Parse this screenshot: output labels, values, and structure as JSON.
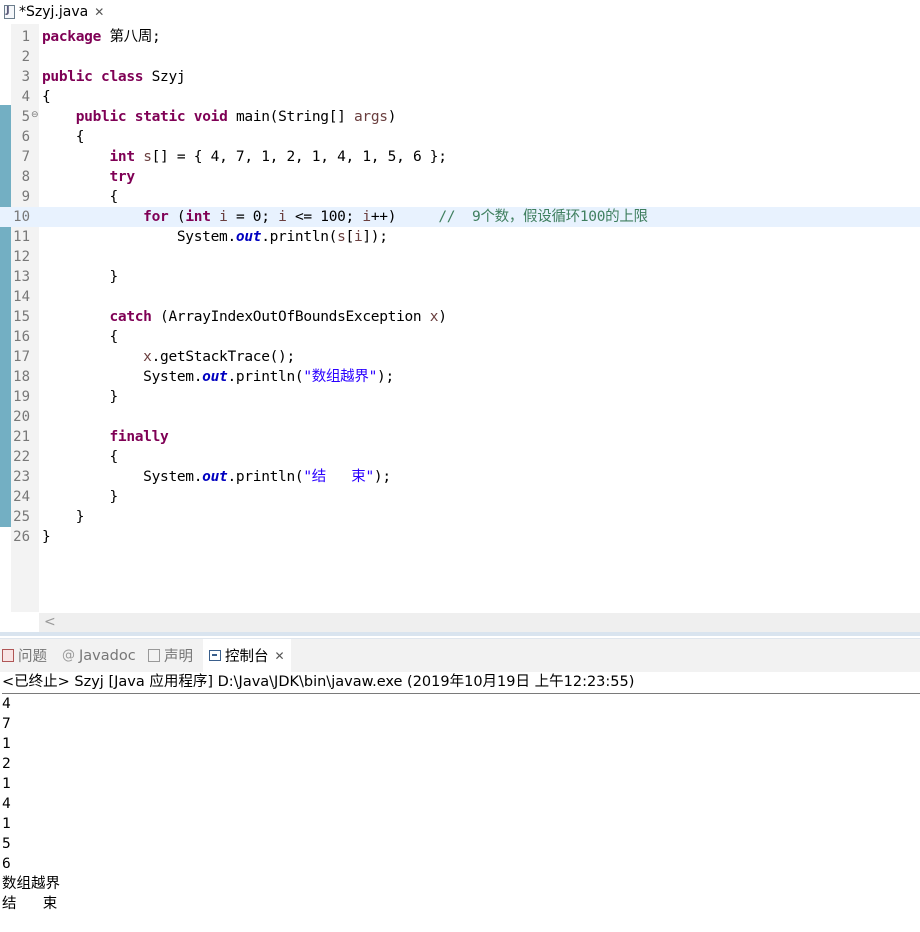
{
  "editor_tab": {
    "title": "*Szyj.java",
    "close": "✕"
  },
  "code_lines": [
    {
      "n": "1",
      "html": "<span class=\"kw\">package</span> 第八周;"
    },
    {
      "n": "2",
      "html": ""
    },
    {
      "n": "3",
      "html": "<span class=\"kw\">public</span> <span class=\"kw\">class</span> Szyj"
    },
    {
      "n": "4",
      "html": "{"
    },
    {
      "n": "5",
      "html": "    <span class=\"kw\">public</span> <span class=\"kw\">static</span> <span class=\"kw\">void</span> main(String[] <span class=\"par\">args</span>)",
      "fold": true
    },
    {
      "n": "6",
      "html": "    {"
    },
    {
      "n": "7",
      "html": "        <span class=\"kw\">int</span> <span class=\"par\">s</span>[] = { 4, 7, 1, 2, 1, 4, 1, 5, 6 };"
    },
    {
      "n": "8",
      "html": "        <span class=\"kw\">try</span>"
    },
    {
      "n": "9",
      "html": "        {"
    },
    {
      "n": "10",
      "html": "            <span class=\"kw\">for</span> (<span class=\"kw\">int</span> <span class=\"par\">i</span> = 0; <span class=\"par\">i</span> &lt;= 100; <span class=\"par\">i</span>++)     <span class=\"cmt\">//  9个数，假设循环100的上限</span>",
      "current": true
    },
    {
      "n": "11",
      "html": "                System.<span class=\"fld\">out</span>.println(<span class=\"par\">s</span>[<span class=\"par\">i</span>]);"
    },
    {
      "n": "12",
      "html": ""
    },
    {
      "n": "13",
      "html": "        }"
    },
    {
      "n": "14",
      "html": ""
    },
    {
      "n": "15",
      "html": "        <span class=\"kw\">catch</span> (ArrayIndexOutOfBoundsException <span class=\"par\">x</span>)"
    },
    {
      "n": "16",
      "html": "        {"
    },
    {
      "n": "17",
      "html": "            <span class=\"par\">x</span>.getStackTrace();"
    },
    {
      "n": "18",
      "html": "            System.<span class=\"fld\">out</span>.println(<span class=\"str\">\"数组越界\"</span>);"
    },
    {
      "n": "19",
      "html": "        }"
    },
    {
      "n": "20",
      "html": ""
    },
    {
      "n": "21",
      "html": "        <span class=\"kw\">finally</span>"
    },
    {
      "n": "22",
      "html": "        {"
    },
    {
      "n": "23",
      "html": "            System.<span class=\"fld\">out</span>.println(<span class=\"str\">\"结   束\"</span>);"
    },
    {
      "n": "24",
      "html": "        }"
    },
    {
      "n": "25",
      "html": "    }"
    },
    {
      "n": "26",
      "html": "}"
    }
  ],
  "console_tabs": [
    {
      "label": "问题",
      "icon": "problems-icon",
      "active": false
    },
    {
      "label": "Javadoc",
      "icon": "javadoc-icon",
      "active": false
    },
    {
      "label": "声明",
      "icon": "declaration-icon",
      "active": false
    },
    {
      "label": "控制台",
      "icon": "console-icon",
      "active": true,
      "close": "✕"
    }
  ],
  "status": "<已终止> Szyj [Java 应用程序] D:\\Java\\JDK\\bin\\javaw.exe  (2019年10月19日 上午12:23:55)",
  "output_lines": [
    "4",
    "7",
    "1",
    "2",
    "1",
    "4",
    "1",
    "5",
    "6",
    "数组越界",
    "结   束"
  ]
}
